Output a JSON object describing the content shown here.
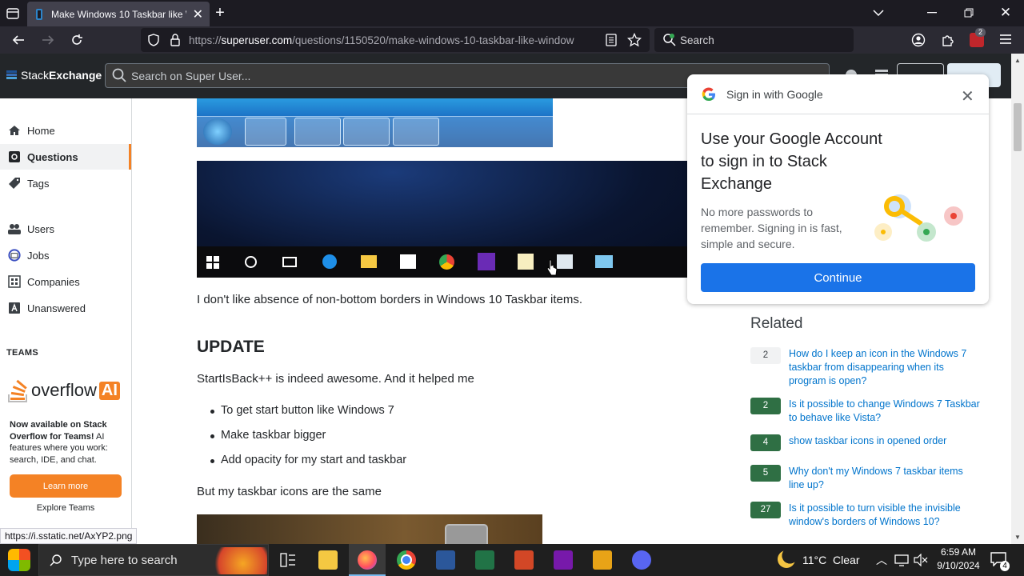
{
  "browser": {
    "tab_title": "Make Windows 10 Taskbar like W",
    "url_prefix": "https://",
    "url_domain": "superuser.com",
    "url_rest": "/questions/1150520/make-windows-10-taskbar-like-window",
    "search_placeholder": "Search",
    "ext_badge": "2"
  },
  "site": {
    "logo_stack": "Stack",
    "logo_exchange": "Exchange",
    "search_placeholder": "Search on Super User..."
  },
  "leftnav": {
    "items": [
      {
        "label": "Home",
        "icon": "home-icon"
      },
      {
        "label": "Questions",
        "icon": "questions-icon",
        "active": true
      },
      {
        "label": "Tags",
        "icon": "tag-icon"
      },
      {
        "label": "Users",
        "icon": "users-icon"
      },
      {
        "label": "Jobs",
        "icon": "jobs-icon"
      },
      {
        "label": "Companies",
        "icon": "companies-icon"
      },
      {
        "label": "Unanswered",
        "icon": "unanswered-icon"
      }
    ],
    "teams_heading": "TEAMS",
    "overflow_ai_logo_a": "overflow",
    "overflow_ai_logo_b": "AI",
    "ai_bold": "Now available on Stack Overflow for Teams!",
    "ai_rest": " AI features where you work: search, IDE, and chat.",
    "learn_more": "Learn more",
    "explore_teams": "Explore Teams"
  },
  "post": {
    "para1": "I don't like absence of non-bottom borders in Windows 10 Taskbar items.",
    "heading": "UPDATE",
    "para2": "StartIsBack++ is indeed awesome. And it helped me",
    "bullets": [
      "To get start button like Windows 7",
      "Make taskbar bigger",
      "Add opacity for my start and taskbar"
    ],
    "para3": "But my taskbar icons are the same"
  },
  "google_popup": {
    "header": "Sign in with Google",
    "title_line1": "Use your Google Account",
    "title_line2": "to sign in to Stack",
    "title_line3": "Exchange",
    "body_line1": "No more passwords to",
    "body_line2": "remember. Signing in is fast,",
    "body_line3": "simple and secure.",
    "continue": "Continue"
  },
  "related": {
    "heading": "Related",
    "items": [
      {
        "score": "2",
        "accepted": false,
        "line1": "How do I keep an icon in the Windows 7",
        "line2": "taskbar from disappearing when its",
        "line3": "program is open?"
      },
      {
        "score": "2",
        "accepted": true,
        "line1": "Is it possible to change Windows 7 Taskbar",
        "line2": "to behave like Vista?",
        "line3": ""
      },
      {
        "score": "4",
        "accepted": true,
        "line1": "show taskbar icons in opened order",
        "line2": "",
        "line3": ""
      },
      {
        "score": "5",
        "accepted": true,
        "line1": "Why don't my Windows 7 taskbar items",
        "line2": "line up?",
        "line3": ""
      },
      {
        "score": "27",
        "accepted": true,
        "line1": "Is it possible to turn visible the invisible",
        "line2": "window's borders of Windows 10?",
        "line3": ""
      }
    ]
  },
  "status_url": "https://i.sstatic.net/AxYP2.png",
  "taskbar": {
    "search_placeholder": "Type here to search",
    "weather": "11°C  Clear",
    "time": "6:59 AM",
    "date": "9/10/2024",
    "notif_count": "4"
  }
}
